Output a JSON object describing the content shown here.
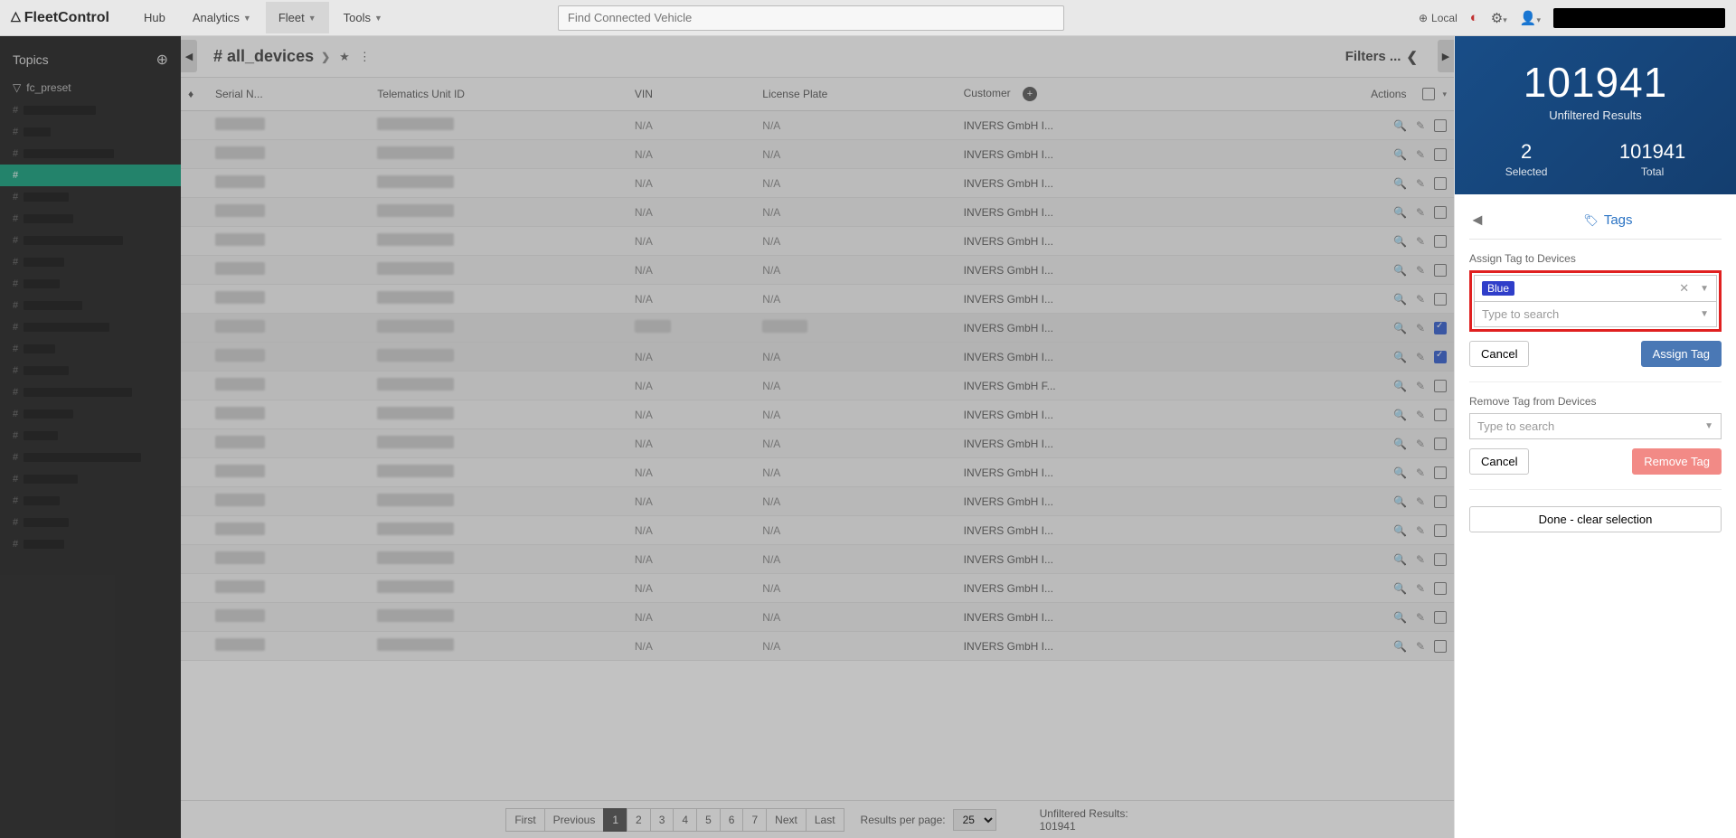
{
  "brand": "FleetControl",
  "nav": {
    "items": [
      "Hub",
      "Analytics",
      "Fleet",
      "Tools"
    ],
    "active_index": 2,
    "search_placeholder": "Find Connected Vehicle",
    "local_label": "Local"
  },
  "sidebar": {
    "title": "Topics",
    "preset": "fc_preset"
  },
  "center": {
    "breadcrumb": "# all_devices",
    "filters_label": "Filters ...",
    "columns": [
      "Serial N...",
      "Telematics Unit ID",
      "VIN",
      "License Plate",
      "Customer",
      "Actions"
    ],
    "add_column_title": "Add column",
    "rows": [
      {
        "vin": "N/A",
        "plate": "N/A",
        "customer": "INVERS GmbH I...",
        "checked": false
      },
      {
        "vin": "N/A",
        "plate": "N/A",
        "customer": "INVERS GmbH I...",
        "checked": false
      },
      {
        "vin": "N/A",
        "plate": "N/A",
        "customer": "INVERS GmbH I...",
        "checked": false
      },
      {
        "vin": "N/A",
        "plate": "N/A",
        "customer": "INVERS GmbH I...",
        "checked": false
      },
      {
        "vin": "N/A",
        "plate": "N/A",
        "customer": "INVERS GmbH I...",
        "checked": false
      },
      {
        "vin": "N/A",
        "plate": "N/A",
        "customer": "INVERS GmbH I...",
        "checked": false
      },
      {
        "vin": "N/A",
        "plate": "N/A",
        "customer": "INVERS GmbH I...",
        "checked": false
      },
      {
        "vin": "",
        "plate": "",
        "customer": "INVERS GmbH I...",
        "checked": true,
        "selected": true,
        "has_vin_blur": true,
        "has_plate_blur": true
      },
      {
        "vin": "N/A",
        "plate": "N/A",
        "customer": "INVERS GmbH I...",
        "checked": true,
        "selected": true
      },
      {
        "vin": "N/A",
        "plate": "N/A",
        "customer": "INVERS GmbH F...",
        "checked": false
      },
      {
        "vin": "N/A",
        "plate": "N/A",
        "customer": "INVERS GmbH I...",
        "checked": false
      },
      {
        "vin": "N/A",
        "plate": "N/A",
        "customer": "INVERS GmbH I...",
        "checked": false
      },
      {
        "vin": "N/A",
        "plate": "N/A",
        "customer": "INVERS GmbH I...",
        "checked": false
      },
      {
        "vin": "N/A",
        "plate": "N/A",
        "customer": "INVERS GmbH I...",
        "checked": false
      },
      {
        "vin": "N/A",
        "plate": "N/A",
        "customer": "INVERS GmbH I...",
        "checked": false
      },
      {
        "vin": "N/A",
        "plate": "N/A",
        "customer": "INVERS GmbH I...",
        "checked": false
      },
      {
        "vin": "N/A",
        "plate": "N/A",
        "customer": "INVERS GmbH I...",
        "checked": false
      },
      {
        "vin": "N/A",
        "plate": "N/A",
        "customer": "INVERS GmbH I...",
        "checked": false
      },
      {
        "vin": "N/A",
        "plate": "N/A",
        "customer": "INVERS GmbH I...",
        "checked": false
      }
    ]
  },
  "pager": {
    "first": "First",
    "prev": "Previous",
    "pages": [
      "1",
      "2",
      "3",
      "4",
      "5",
      "6",
      "7"
    ],
    "active_page": "1",
    "next": "Next",
    "last": "Last",
    "rpp_label": "Results per page:",
    "rpp_value": "25",
    "unfiltered_label": "Unfiltered Results:",
    "unfiltered_value": "101941"
  },
  "right": {
    "hero_number": "101941",
    "hero_label": "Unfiltered Results",
    "selected_n": "2",
    "selected_l": "Selected",
    "total_n": "101941",
    "total_l": "Total",
    "tags_title": "Tags",
    "assign_label": "Assign Tag to Devices",
    "assign_chip": "Blue",
    "type_search": "Type to search",
    "cancel": "Cancel",
    "assign_btn": "Assign Tag",
    "remove_label": "Remove Tag from Devices",
    "remove_btn": "Remove Tag",
    "done_btn": "Done - clear selection"
  }
}
